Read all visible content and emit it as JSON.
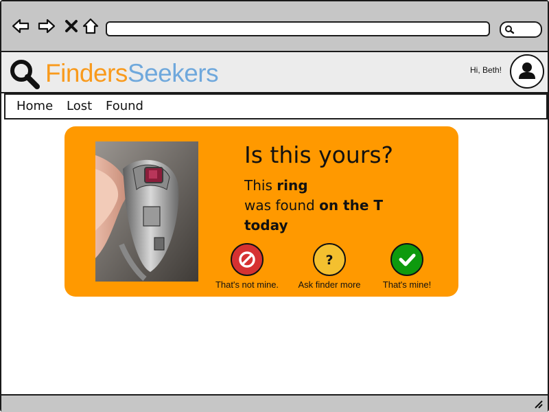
{
  "browser": {
    "icons": [
      "back-arrow-icon",
      "forward-arrow-icon",
      "close-icon",
      "home-icon",
      "search-icon"
    ]
  },
  "header": {
    "brand_part1": "Finders",
    "brand_part2": "Seekers",
    "greeting": "Hi, Beth!",
    "brand_colors": {
      "finders": "#f99a1c",
      "seekers": "#6fa8dc"
    }
  },
  "nav": {
    "items": [
      {
        "label": "Home"
      },
      {
        "label": "Lost"
      },
      {
        "label": "Found"
      }
    ]
  },
  "card": {
    "question": "Is this yours?",
    "line1_prefix": "This ",
    "item": "ring",
    "line2_prefix": "was found ",
    "location": "on the T",
    "when": "today",
    "background": "#ff9900",
    "actions": [
      {
        "label": "That's not mine.",
        "icon": "prohibited-icon",
        "color": "#d63232"
      },
      {
        "label": "Ask finder more",
        "icon": "question-icon",
        "color": "#f4c02f"
      },
      {
        "label": "That's mine!",
        "icon": "checkmark-icon",
        "color": "#0e9a0e"
      }
    ]
  }
}
